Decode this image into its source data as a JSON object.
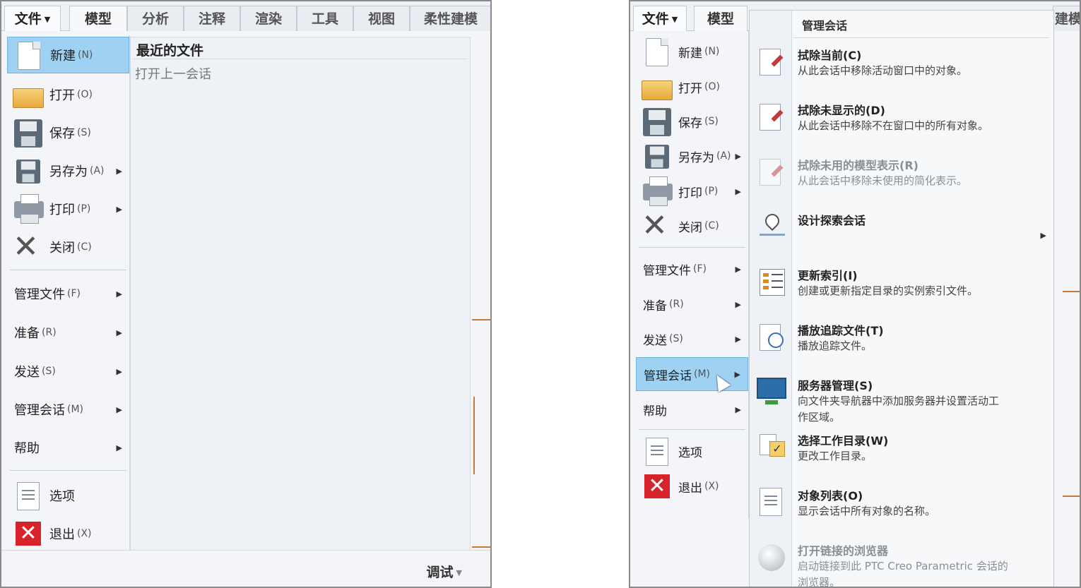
{
  "left": {
    "tabs": [
      {
        "label": "文件"
      },
      {
        "label": "模型"
      },
      {
        "label": "分析"
      },
      {
        "label": "注释"
      },
      {
        "label": "渲染"
      },
      {
        "label": "工具"
      },
      {
        "label": "视图"
      },
      {
        "label": "柔性建模"
      }
    ],
    "menu": {
      "new": {
        "label": "新建",
        "acc": "(N)"
      },
      "open": {
        "label": "打开",
        "acc": "(O)"
      },
      "save": {
        "label": "保存",
        "acc": "(S)"
      },
      "saveas": {
        "label": "另存为",
        "acc": "(A)"
      },
      "print": {
        "label": "打印",
        "acc": "(P)"
      },
      "close": {
        "label": "关闭",
        "acc": "(C)"
      },
      "manage_file": {
        "label": "管理文件",
        "acc": "(F)"
      },
      "prepare": {
        "label": "准备",
        "acc": "(R)"
      },
      "send": {
        "label": "发送",
        "acc": "(S)"
      },
      "manage_session": {
        "label": "管理会话",
        "acc": "(M)"
      },
      "help": {
        "label": "帮助"
      },
      "options": {
        "label": "选项"
      },
      "exit": {
        "label": "退出",
        "acc": "(X)"
      }
    },
    "recent": {
      "title": "最近的文件",
      "subtitle": "打开上一会话"
    },
    "footer": {
      "debug": "调试"
    }
  },
  "right": {
    "tabs": [
      {
        "label": "文件"
      },
      {
        "label": "模型"
      },
      {
        "label": "建模"
      }
    ],
    "menu": {
      "new": {
        "label": "新建",
        "acc": "(N)"
      },
      "open": {
        "label": "打开",
        "acc": "(O)"
      },
      "save": {
        "label": "保存",
        "acc": "(S)"
      },
      "saveas": {
        "label": "另存为",
        "acc": "(A)"
      },
      "print": {
        "label": "打印",
        "acc": "(P)"
      },
      "close": {
        "label": "关闭",
        "acc": "(C)"
      },
      "manage_file": {
        "label": "管理文件",
        "acc": "(F)"
      },
      "prepare": {
        "label": "准备",
        "acc": "(R)"
      },
      "send": {
        "label": "发送",
        "acc": "(S)"
      },
      "manage_session": {
        "label": "管理会话",
        "acc": "(M)"
      },
      "help": {
        "label": "帮助"
      },
      "options": {
        "label": "选项"
      },
      "exit": {
        "label": "退出",
        "acc": "(X)"
      }
    },
    "submenu": {
      "title": "管理会话",
      "items": [
        {
          "title": "拭除当前(C)",
          "desc": "从此会话中移除活动窗口中的对象。",
          "icon": "erase-current-icon"
        },
        {
          "title": "拭除未显示的(D)",
          "desc": "从此会话中移除不在窗口中的所有对象。",
          "icon": "erase-not-displayed-icon"
        },
        {
          "title": "拭除未用的模型表示(R)",
          "desc": "从此会话中移除未使用的简化表示。",
          "icon": "erase-unused-rep-icon"
        },
        {
          "title": "设计探索会话",
          "desc": "",
          "icon": "pin-icon"
        },
        {
          "title": "更新索引(I)",
          "desc": "创建或更新指定目录的实例索引文件。",
          "icon": "index-icon"
        },
        {
          "title": "播放追踪文件(T)",
          "desc": "播放追踪文件。",
          "icon": "trail-file-icon"
        },
        {
          "title": "服务器管理(S)",
          "desc": "向文件夹导航器中添加服务器并设置活动工作区域。",
          "icon": "server-icon"
        },
        {
          "title": "选择工作目录(W)",
          "desc": "更改工作目录。",
          "icon": "working-dir-icon"
        },
        {
          "title": "对象列表(O)",
          "desc": "显示会话中所有对象的名称。",
          "icon": "object-list-icon"
        },
        {
          "title": "打开链接的浏览器",
          "desc": "启动链接到此 PTC Creo Parametric 会话的浏览器。",
          "icon": "browser-icon"
        }
      ]
    }
  }
}
